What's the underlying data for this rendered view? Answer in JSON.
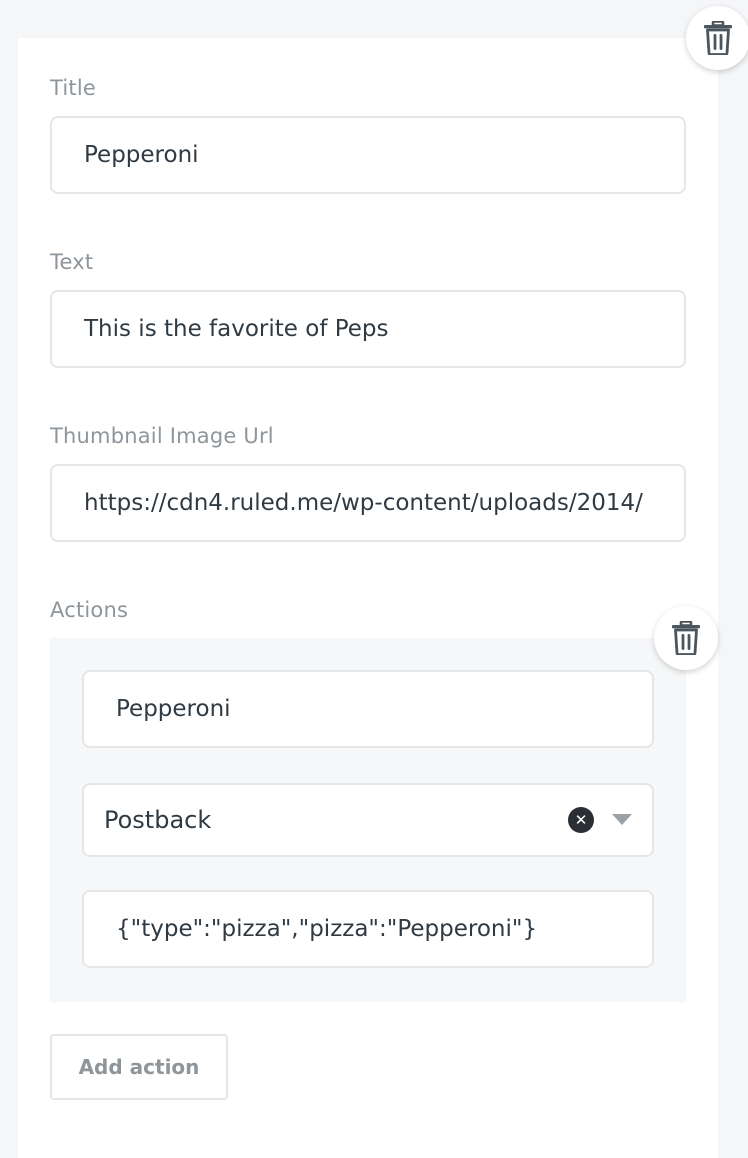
{
  "card": {
    "title_field": {
      "label": "Title",
      "value": "Pepperoni"
    },
    "text_field": {
      "label": "Text",
      "value": "This is the favorite of Peps"
    },
    "thumbnail_field": {
      "label": "Thumbnail Image Url",
      "value": "https://cdn4.ruled.me/wp-content/uploads/2014/"
    },
    "actions": {
      "label": "Actions",
      "items": [
        {
          "title": "Pepperoni",
          "type": "Postback",
          "payload": "{\"type\":\"pizza\",\"pizza\":\"Pepperoni\"}"
        }
      ],
      "add_label": "Add action"
    }
  },
  "icons": {
    "delete_card": "trash-icon",
    "delete_action": "trash-icon",
    "clear": "close-icon",
    "dropdown": "chevron-down-icon"
  }
}
